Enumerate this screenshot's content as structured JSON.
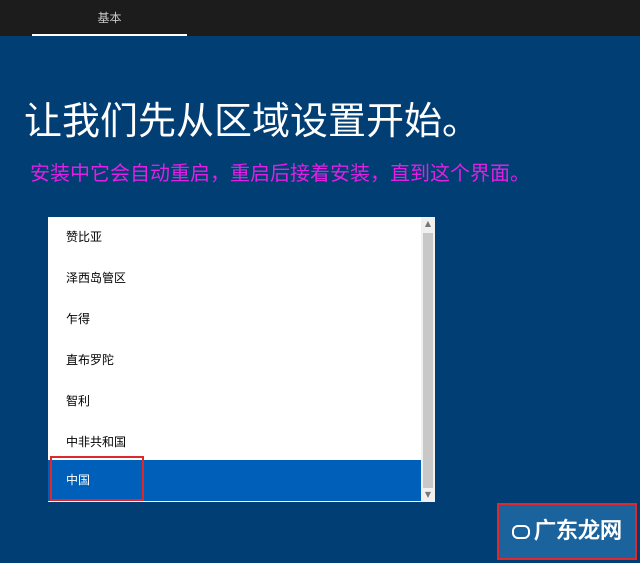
{
  "header": {
    "tab_label": "基本"
  },
  "page": {
    "title": "让我们先从区域设置开始。",
    "annotation": "安装中它会自动重启，重启后接着安装，直到这个界面。"
  },
  "region_list": {
    "items": [
      "赞比亚",
      "泽西岛管区",
      "乍得",
      "直布罗陀",
      "智利",
      "中非共和国",
      "中国"
    ],
    "selected": "中国"
  },
  "watermark": {
    "text": "广东龙网"
  },
  "colors": {
    "background": "#003e73",
    "selected": "#005fb8",
    "annotation": "#e41ee4",
    "highlight": "#e0272b"
  }
}
